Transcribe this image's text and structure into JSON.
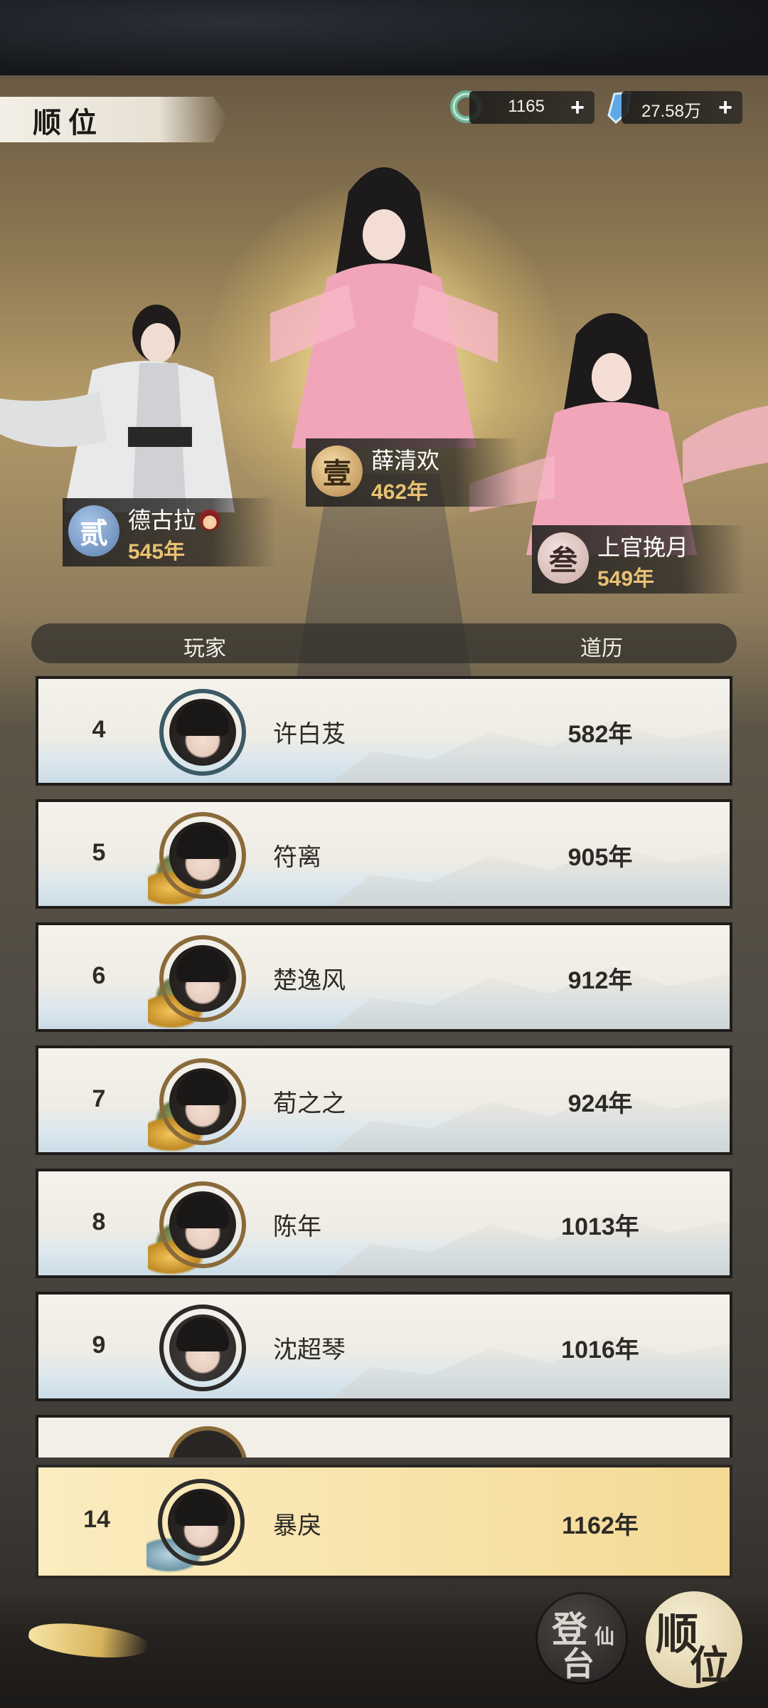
{
  "header": {
    "title": "顺位"
  },
  "currencies": [
    {
      "icon": "jade-ring-icon",
      "value": "1165"
    },
    {
      "icon": "spirit-crystal-icon",
      "value": "27.58万"
    }
  ],
  "podium": [
    {
      "medal": "壹",
      "name": "薛清欢",
      "years": "462年"
    },
    {
      "medal": "贰",
      "name": "德古拉",
      "badge": "vampire-emoji",
      "years": "545年"
    },
    {
      "medal": "叁",
      "name": "上官挽月",
      "years": "549年"
    }
  ],
  "table": {
    "col_player": "玩家",
    "col_value": "道历",
    "rows": [
      {
        "rank": "4",
        "name": "许白芨",
        "value": "582年"
      },
      {
        "rank": "5",
        "name": "符离",
        "value": "905年"
      },
      {
        "rank": "6",
        "name": "楚逸风",
        "value": "912年"
      },
      {
        "rank": "7",
        "name": "荀之之",
        "value": "924年"
      },
      {
        "rank": "8",
        "name": "陈年",
        "value": "1013年"
      },
      {
        "rank": "9",
        "name": "沈超琴",
        "value": "1016年"
      }
    ]
  },
  "self_row": {
    "rank": "14",
    "name": "暴戾",
    "value": "1162年"
  },
  "bottom_nav": {
    "left": {
      "c1": "登",
      "c2": "仙",
      "c3": "台"
    },
    "right": {
      "c1": "顺",
      "c2": "位"
    }
  },
  "colors": {
    "gold": "#e9c173",
    "self_row": "#f7e2a8",
    "frame": "#1f1d1a"
  }
}
